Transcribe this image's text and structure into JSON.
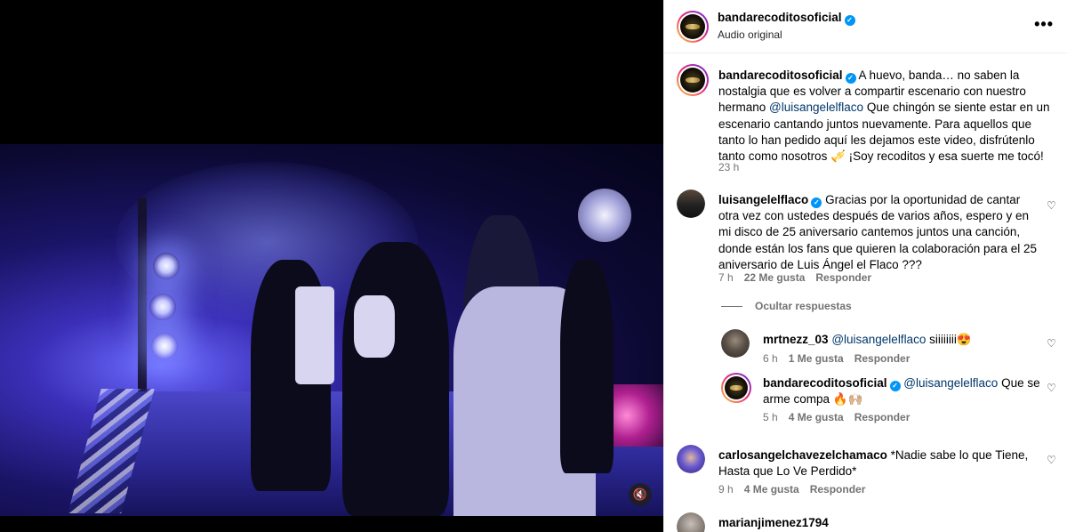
{
  "header": {
    "username": "bandarecoditosoficial",
    "subtitle": "Audio original",
    "more": "•••"
  },
  "video": {
    "mute_icon": "🔇"
  },
  "caption": {
    "username": "bandarecoditosoficial",
    "text_1": "A huevo, banda… no saben la",
    "text_2": "nostalgia que es volver a compartir escenario con nuestro",
    "text_3a": "hermano ",
    "mention": "@luisangelelflaco",
    "text_3b": " Que chingón se siente estar en un",
    "text_4": "escenario cantando juntos nuevamente. Para aquellos que",
    "text_5": "tanto lo han pedido aquí les dejamos este video, disfrútenlo",
    "text_6": "tanto como nosotros 🎺 ¡Soy recoditos y esa suerte me tocó!",
    "time": "23 h"
  },
  "comments": [
    {
      "username": "luisangelelflaco",
      "line_1": "Gracias por la oportunidad de cantar",
      "line_2": "otra vez con ustedes después de varios años, espero y en",
      "line_3": "mi disco de 25 aniversario cantemos juntos una canción,",
      "line_4": "donde están los fans que quieren la colaboración para el 25",
      "line_5": "aniversario de Luis Ángel el Flaco ???",
      "time": "7 h",
      "likes": "22 Me gusta",
      "reply": "Responder"
    },
    {
      "username": "mrtnezz_03",
      "mention": "@luisangelelflaco",
      "text": " siiiiiiii😍",
      "time": "6 h",
      "likes": "1 Me gusta",
      "reply": "Responder"
    },
    {
      "username": "bandarecoditosoficial",
      "mention": "@luisangelelflaco",
      "text": " Que se",
      "line_2": "arme compa 🔥🙌🏼",
      "time": "5 h",
      "likes": "4 Me gusta",
      "reply": "Responder"
    },
    {
      "username": "carlosangelchavezelchamaco",
      "text": " *Nadie sabe lo que Tiene,",
      "line_2": "Hasta que Lo Ve Perdido*",
      "time": "9 h",
      "likes": "4 Me gusta",
      "reply": "Responder"
    },
    {
      "username": "marianjimenez1794"
    }
  ],
  "hide_replies": "Ocultar respuestas",
  "heart_icon": "♡"
}
